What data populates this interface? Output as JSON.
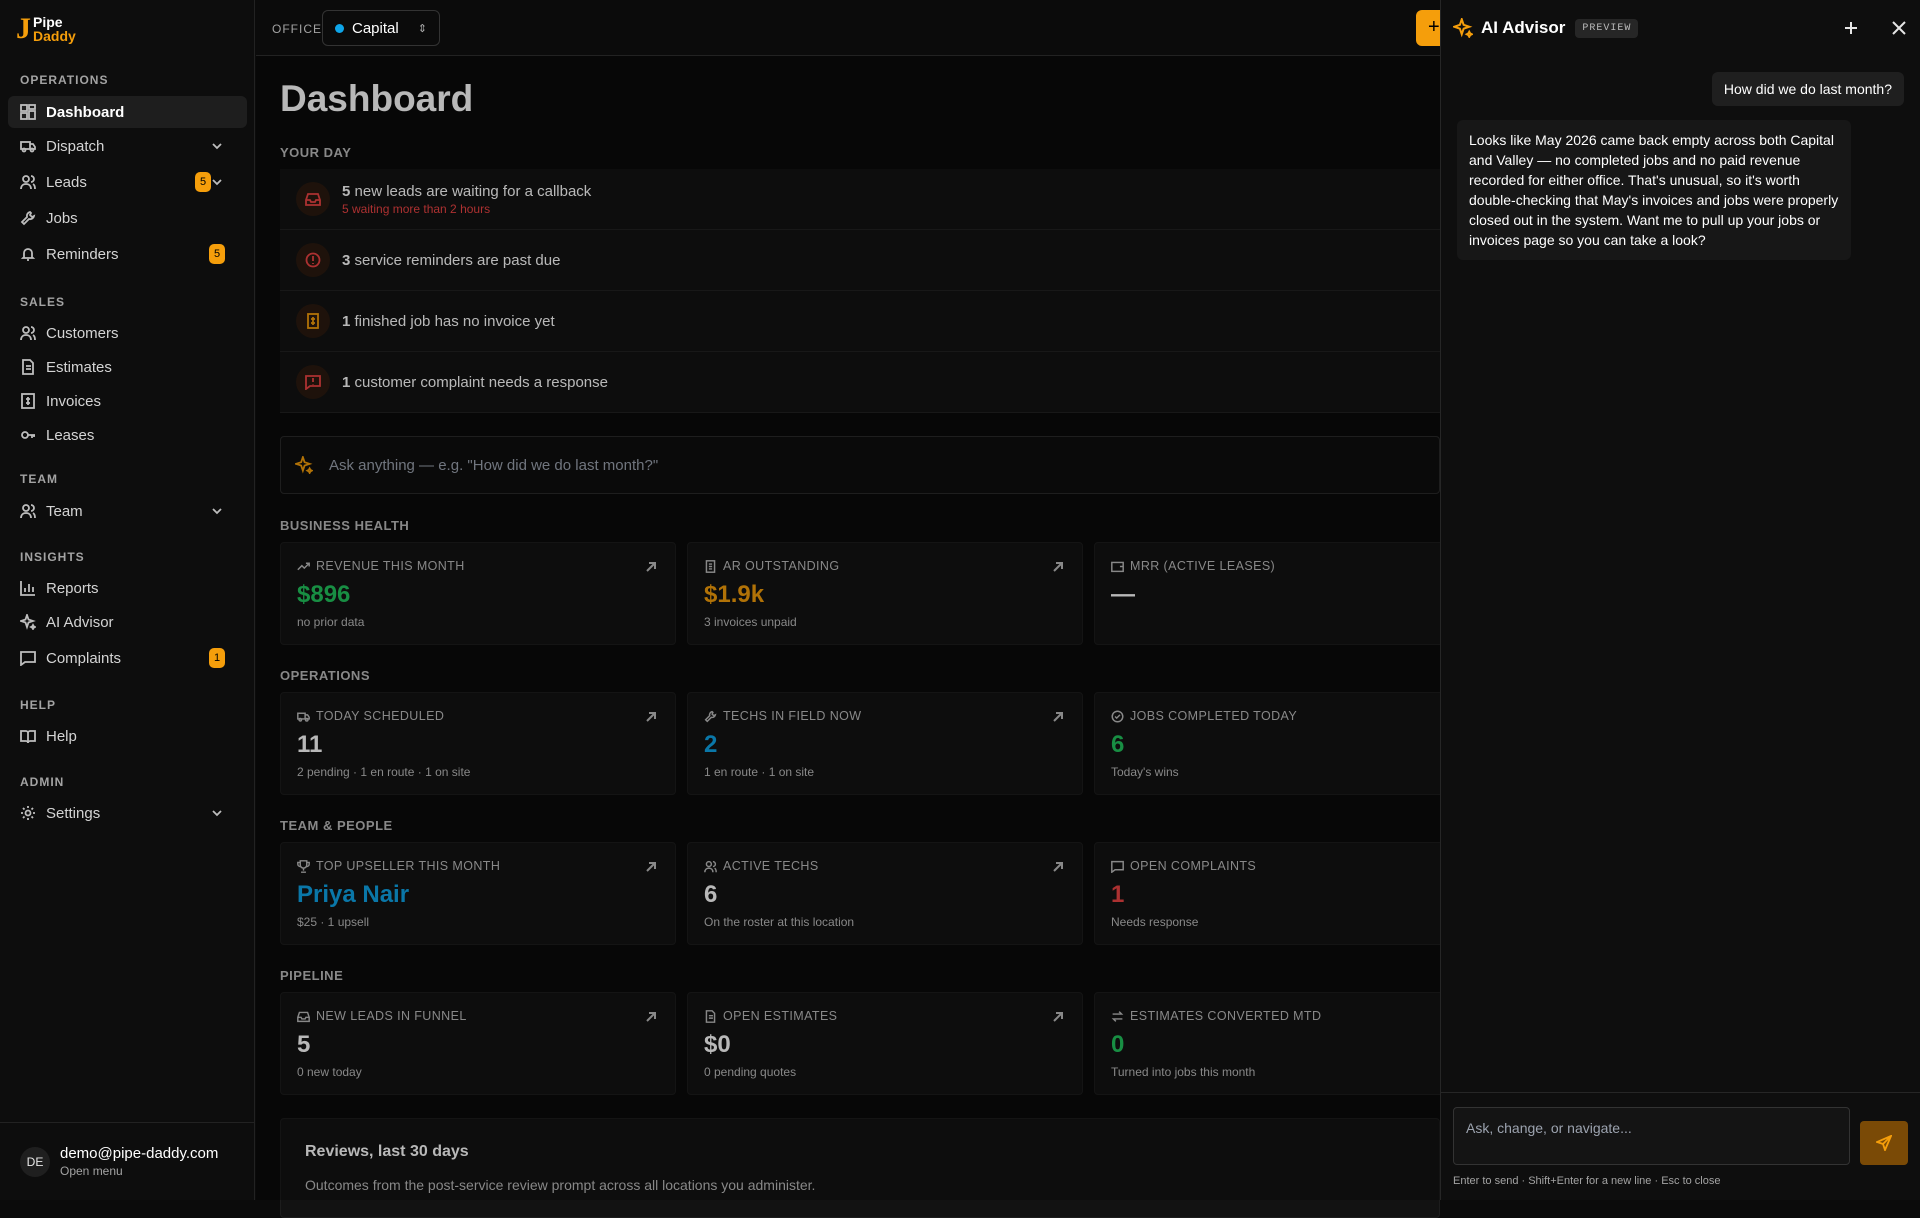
{
  "brand": {
    "line1": "Pipe",
    "line2": "Daddy",
    "mark": "J"
  },
  "sidebar": {
    "sections": [
      "OPERATIONS",
      "SALES",
      "TEAM",
      "INSIGHTS",
      "HELP",
      "ADMIN"
    ],
    "items": [
      {
        "label": "Dashboard",
        "icon": "dashboard-icon"
      },
      {
        "label": "Dispatch",
        "icon": "truck-icon"
      },
      {
        "label": "Leads",
        "icon": "users-icon",
        "badge": "5"
      },
      {
        "label": "Jobs",
        "icon": "wrench-icon"
      },
      {
        "label": "Reminders",
        "icon": "bell-icon",
        "badge": "5"
      },
      {
        "label": "Customers",
        "icon": "users-icon"
      },
      {
        "label": "Estimates",
        "icon": "file-icon"
      },
      {
        "label": "Invoices",
        "icon": "receipt-icon"
      },
      {
        "label": "Leases",
        "icon": "key-icon"
      },
      {
        "label": "Team",
        "icon": "users-icon"
      },
      {
        "label": "Reports",
        "icon": "chart-icon"
      },
      {
        "label": "AI Advisor",
        "icon": "sparkles-icon"
      },
      {
        "label": "Complaints",
        "icon": "message-icon",
        "badge": "1"
      },
      {
        "label": "Help",
        "icon": "book-icon"
      },
      {
        "label": "Settings",
        "icon": "gear-icon"
      }
    ],
    "user": {
      "initials": "DE",
      "email": "demo@pipe-daddy.com",
      "menu": "Open menu"
    }
  },
  "topbar": {
    "office_label": "OFFICE",
    "office_value": "Capital",
    "new_label": "+"
  },
  "main": {
    "title": "Dashboard",
    "your_day_label": "YOUR DAY",
    "your_day": [
      {
        "count": "5",
        "text": " new leads are waiting for a callback",
        "sub": "5 waiting more than 2 hours"
      },
      {
        "count": "3",
        "text": " service reminders are past due"
      },
      {
        "count": "1",
        "text": " finished job has no invoice yet"
      },
      {
        "count": "1",
        "text": " customer complaint needs a response"
      }
    ],
    "ask_placeholder": "Ask anything — e.g. \"How did we do last month?\"",
    "business_health_label": "BUSINESS HEALTH",
    "business_health": [
      {
        "label": "REVENUE THIS MONTH",
        "value": "$896",
        "sub": "no prior data"
      },
      {
        "label": "AR OUTSTANDING",
        "value": "$1.9k",
        "sub": "3 invoices unpaid"
      },
      {
        "label": "MRR (ACTIVE LEASES)",
        "value": "—",
        "sub": ""
      }
    ],
    "operations_label": "OPERATIONS",
    "operations": [
      {
        "label": "TODAY SCHEDULED",
        "value": "11",
        "sub": "2 pending · 1 en route · 1 on site"
      },
      {
        "label": "TECHS IN FIELD NOW",
        "value": "2",
        "sub": "1 en route · 1 on site"
      },
      {
        "label": "JOBS COMPLETED TODAY",
        "value": "6",
        "sub": "Today's wins"
      }
    ],
    "team_label": "TEAM & PEOPLE",
    "team": [
      {
        "label": "TOP UPSELLER THIS MONTH",
        "value": "Priya Nair",
        "sub": "$25 · 1 upsell"
      },
      {
        "label": "ACTIVE TECHS",
        "value": "6",
        "sub": "On the roster at this location"
      },
      {
        "label": "OPEN COMPLAINTS",
        "value": "1",
        "sub": "Needs response"
      }
    ],
    "pipeline_label": "PIPELINE",
    "pipeline": [
      {
        "label": "NEW LEADS IN FUNNEL",
        "value": "5",
        "sub": "0 new today"
      },
      {
        "label": "OPEN ESTIMATES",
        "value": "$0",
        "sub": "0 pending quotes"
      },
      {
        "label": "ESTIMATES CONVERTED MTD",
        "value": "0",
        "sub": "Turned into jobs this month"
      }
    ],
    "reviews": {
      "title": "Reviews, last 30 days",
      "desc": "Outcomes from the post-service review prompt across all locations you administer."
    }
  },
  "advisor": {
    "title": "AI Advisor",
    "preview": "PREVIEW",
    "user_msg": "How did we do last month?",
    "ai_msg": "Looks like May 2026 came back empty across both Capital and Valley — no completed jobs and no paid revenue recorded for either office. That's unusual, so it's worth double-checking that May's invoices and jobs were properly closed out in the system. Want me to pull up your jobs or invoices page so you can take a look?",
    "input_placeholder": "Ask, change, or navigate...",
    "hint": "Enter to send · Shift+Enter for a new line · Esc to close"
  },
  "colors": {
    "accent": "#f59e0b",
    "positive": "#22c55e",
    "info": "#0ea5e9",
    "danger": "#ef4444"
  }
}
